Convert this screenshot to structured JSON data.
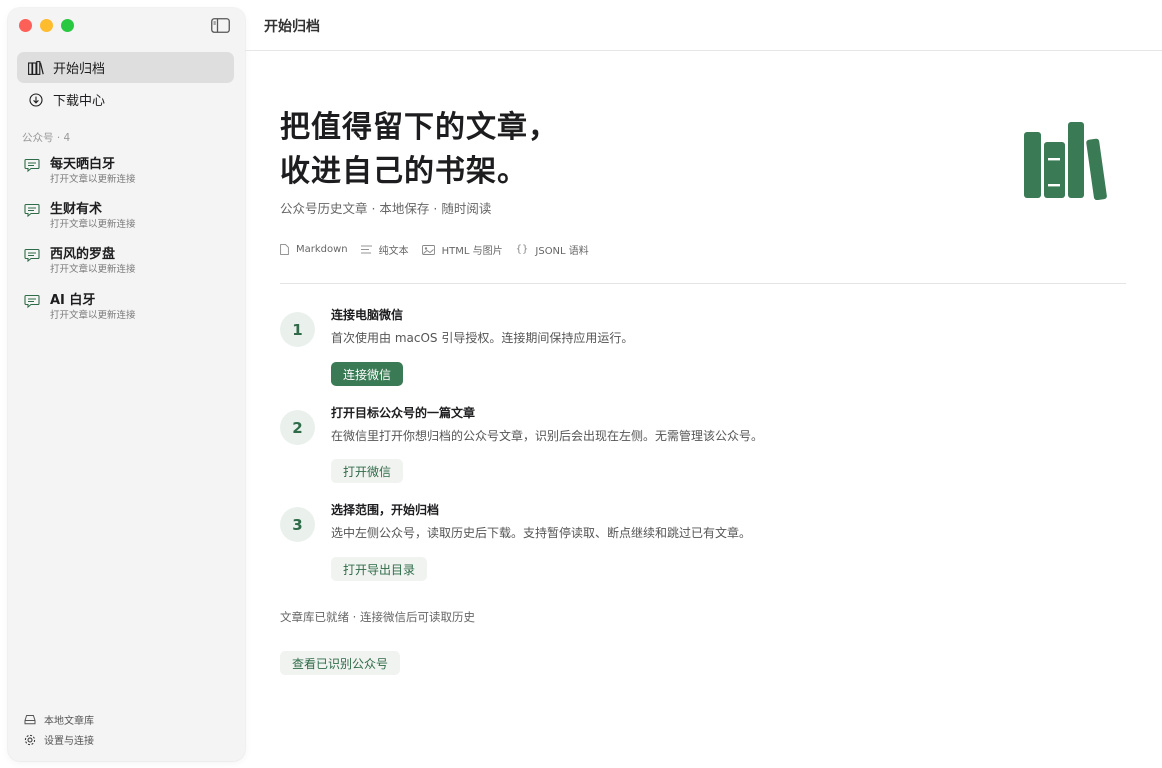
{
  "window": {
    "title": "开始归档"
  },
  "sidebar": {
    "nav": [
      {
        "label": "开始归档",
        "icon": "books-icon",
        "active": true
      },
      {
        "label": "下载中心",
        "icon": "download-circle-icon",
        "active": false
      }
    ],
    "section_label": "公众号 · 4",
    "accounts": [
      {
        "name": "每天晒白牙",
        "status": "打开文章以更新连接",
        "icon": "chat-bubble-icon"
      },
      {
        "name": "生财有术",
        "status": "打开文章以更新连接",
        "icon": "chat-bubble-icon"
      },
      {
        "name": "西风的罗盘",
        "status": "打开文章以更新连接",
        "icon": "chat-bubble-icon"
      },
      {
        "name": "AI 白牙",
        "status": "打开文章以更新连接",
        "icon": "chat-bubble-icon"
      }
    ],
    "footer": {
      "library": "本地文章库",
      "settings": "设置与连接"
    }
  },
  "main": {
    "hero": {
      "title_line1": "把值得留下的文章，",
      "title_line2": "收进自己的书架。",
      "subtitle": "公众号历史文章 · 本地保存 · 随时阅读"
    },
    "formats": [
      {
        "label": "Markdown",
        "icon": "document-icon"
      },
      {
        "label": "纯文本",
        "icon": "text-lines-icon"
      },
      {
        "label": "HTML 与图片",
        "icon": "image-icon"
      },
      {
        "label": "JSONL 语料",
        "icon": "braces-icon"
      }
    ],
    "steps": [
      {
        "number": "1",
        "title": "连接电脑微信",
        "description": "首次使用由 macOS 引导授权。连接期间保持应用运行。",
        "button": "连接微信"
      },
      {
        "number": "2",
        "title": "打开目标公众号的一篇文章",
        "description": "在微信里打开你想归档的公众号文章，识别后会出现在左侧。无需管理该公众号。",
        "button": "打开微信"
      },
      {
        "number": "3",
        "title": "选择范围，开始归档",
        "description": "选中左侧公众号，读取历史后下载。支持暂停读取、断点继续和跳过已有文章。",
        "button": "打开导出目录"
      }
    ],
    "status": "文章库已就绪 · 连接微信后可读取历史",
    "view_button": "查看已识别公众号"
  },
  "colors": {
    "accent": "#3a7a55",
    "accent_light": "#eaf1ec",
    "sidebar_bg": "#f4f4f4"
  }
}
